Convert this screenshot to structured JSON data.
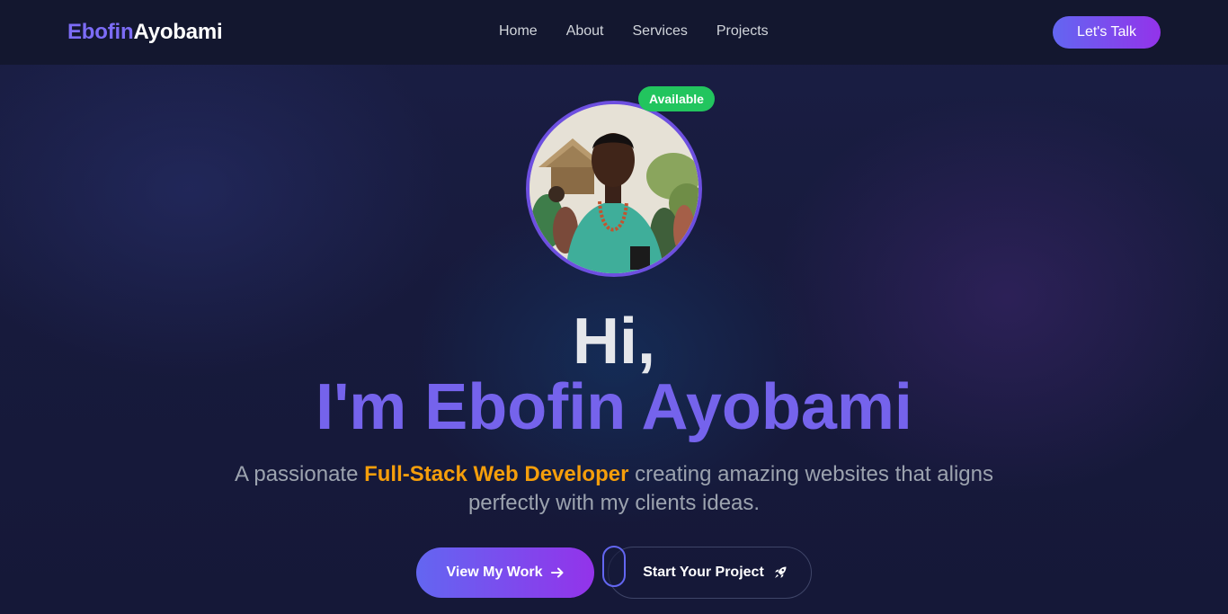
{
  "navbar": {
    "logo_first": "Ebofin",
    "logo_second": "Ayobami",
    "links": [
      "Home",
      "About",
      "Services",
      "Projects"
    ],
    "cta_label": "Let's Talk"
  },
  "hero": {
    "badge": "Available",
    "greeting": "Hi,",
    "name_line": "I'm Ebofin Ayobami",
    "tagline_before": "A passionate ",
    "tagline_highlight": "Full-Stack Web Developer",
    "tagline_after": " creating amazing websites that aligns perfectly with my clients ideas.",
    "primary_button": "View My Work",
    "secondary_button": "Start Your Project",
    "primary_icon": "arrow-right-icon",
    "secondary_icon": "rocket-icon"
  },
  "colors": {
    "accent": "#7563ec",
    "highlight": "#f59e0b",
    "badge": "#22c55e",
    "gradient_start": "#6366f1",
    "gradient_end": "#9333ea"
  }
}
